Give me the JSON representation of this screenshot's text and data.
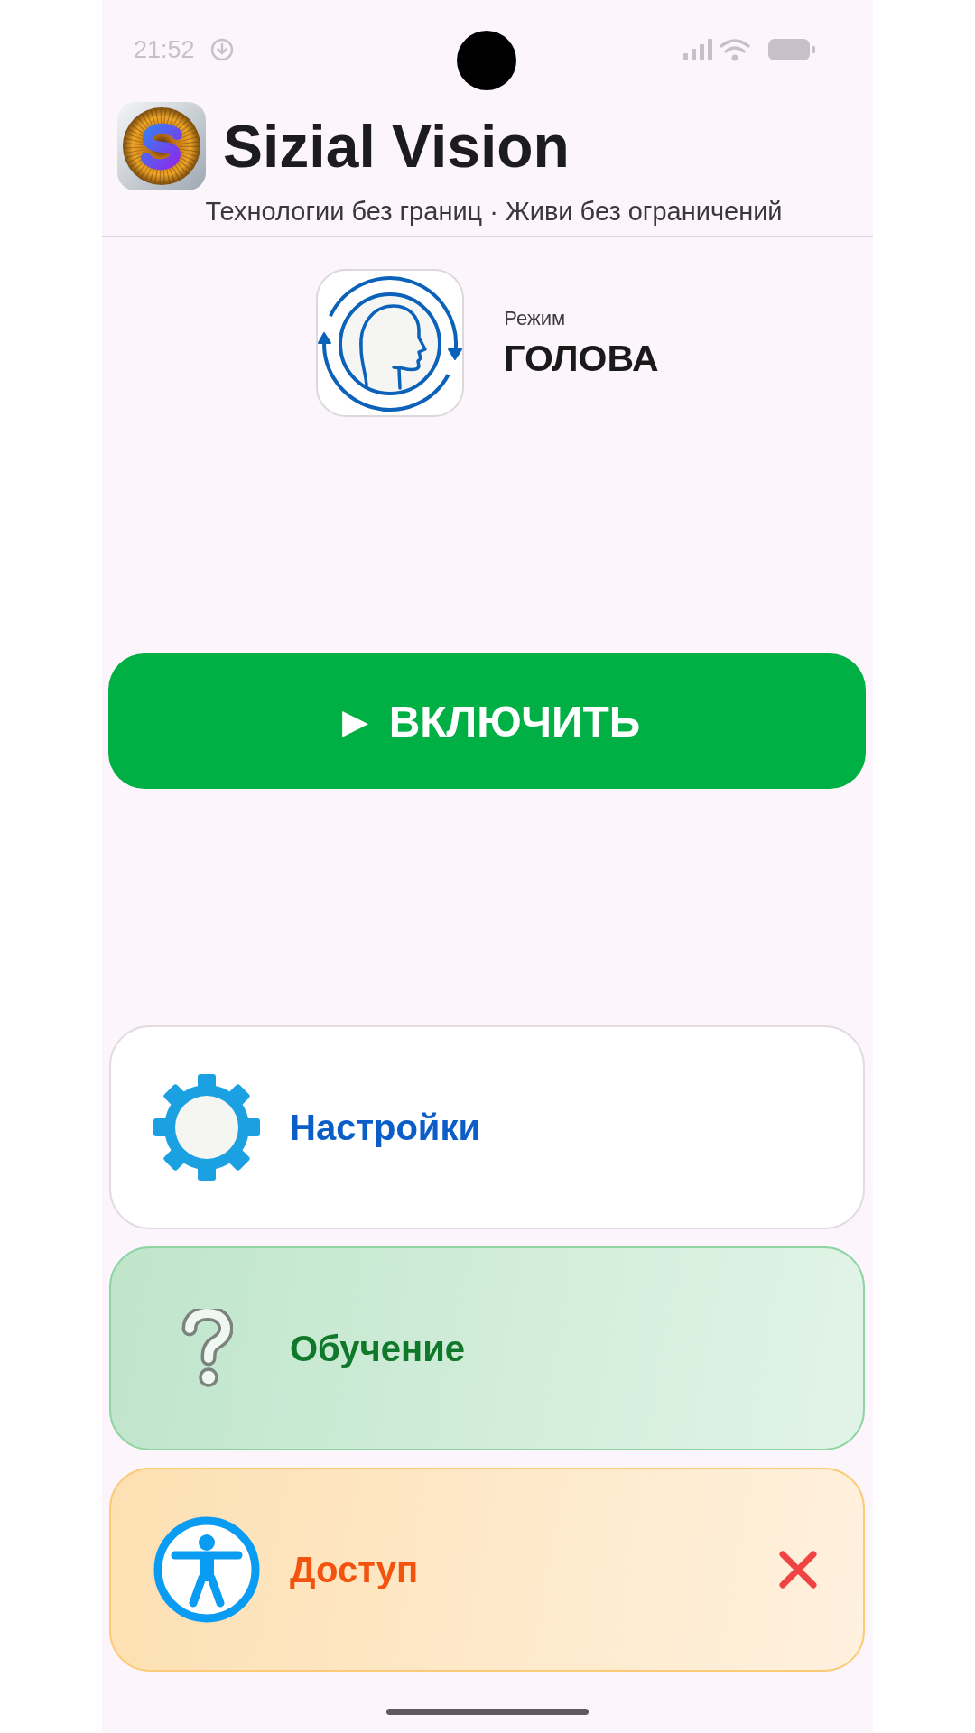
{
  "status_bar": {
    "time": "21:52"
  },
  "header": {
    "title": "Sizial Vision",
    "subtitle": "Технологии без границ · Живи без ограничений"
  },
  "mode": {
    "label": "Режим",
    "value": "ГОЛОВА"
  },
  "start_button": {
    "label": "► ВКЛЮЧИТЬ"
  },
  "menu": [
    {
      "kind": "settings",
      "label": "Настройки"
    },
    {
      "kind": "tutorial",
      "label": "Обучение"
    },
    {
      "kind": "access",
      "label": "Доступ",
      "granted": false
    }
  ]
}
